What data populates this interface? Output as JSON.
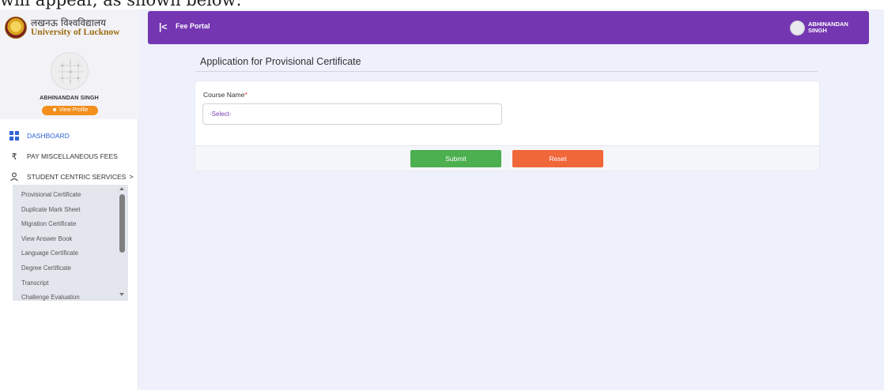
{
  "doc_fragment": "will appear, as shown below:",
  "brand": {
    "hindi": "लखनऊ विश्वविद्यालय",
    "english": "University of Lucknow"
  },
  "profile": {
    "name": "ABHINANDAN SINGH",
    "view_profile": "View Profile",
    "view_profile_icon": "profile-icon"
  },
  "nav": [
    {
      "label": "DASHBOARD",
      "icon": "dashboard-icon",
      "active": true
    },
    {
      "label": "PAY MISCELLANEOUS FEES",
      "icon": "rupee-icon"
    },
    {
      "label": "STUDENT CENTRIC SERVICES",
      "icon": "user-icon",
      "chevron": ">"
    }
  ],
  "submenu": [
    "Provisional Certificate",
    "Duplicate Mark Sheet",
    "Migration Certificate",
    "View Answer Book",
    "Language Certificate",
    "Degree Certificate",
    "Transcript",
    "Challenge Evaluation"
  ],
  "topbar": {
    "collapse_icon": "collapse-left-icon",
    "portal_title": "Fee Portal",
    "user_name": "ABHINANDAN SINGH"
  },
  "form": {
    "title": "Application for Provisional Certificate",
    "course_label": "Course Name",
    "required_mark": "*",
    "course_value": "-Select-",
    "submit": "Submit",
    "reset": "Reset"
  },
  "colors": {
    "primary": "#7436b1",
    "submit": "#4caf50",
    "reset": "#f0673a",
    "badge": "#f28f1d",
    "active_nav": "#2f63d6"
  }
}
